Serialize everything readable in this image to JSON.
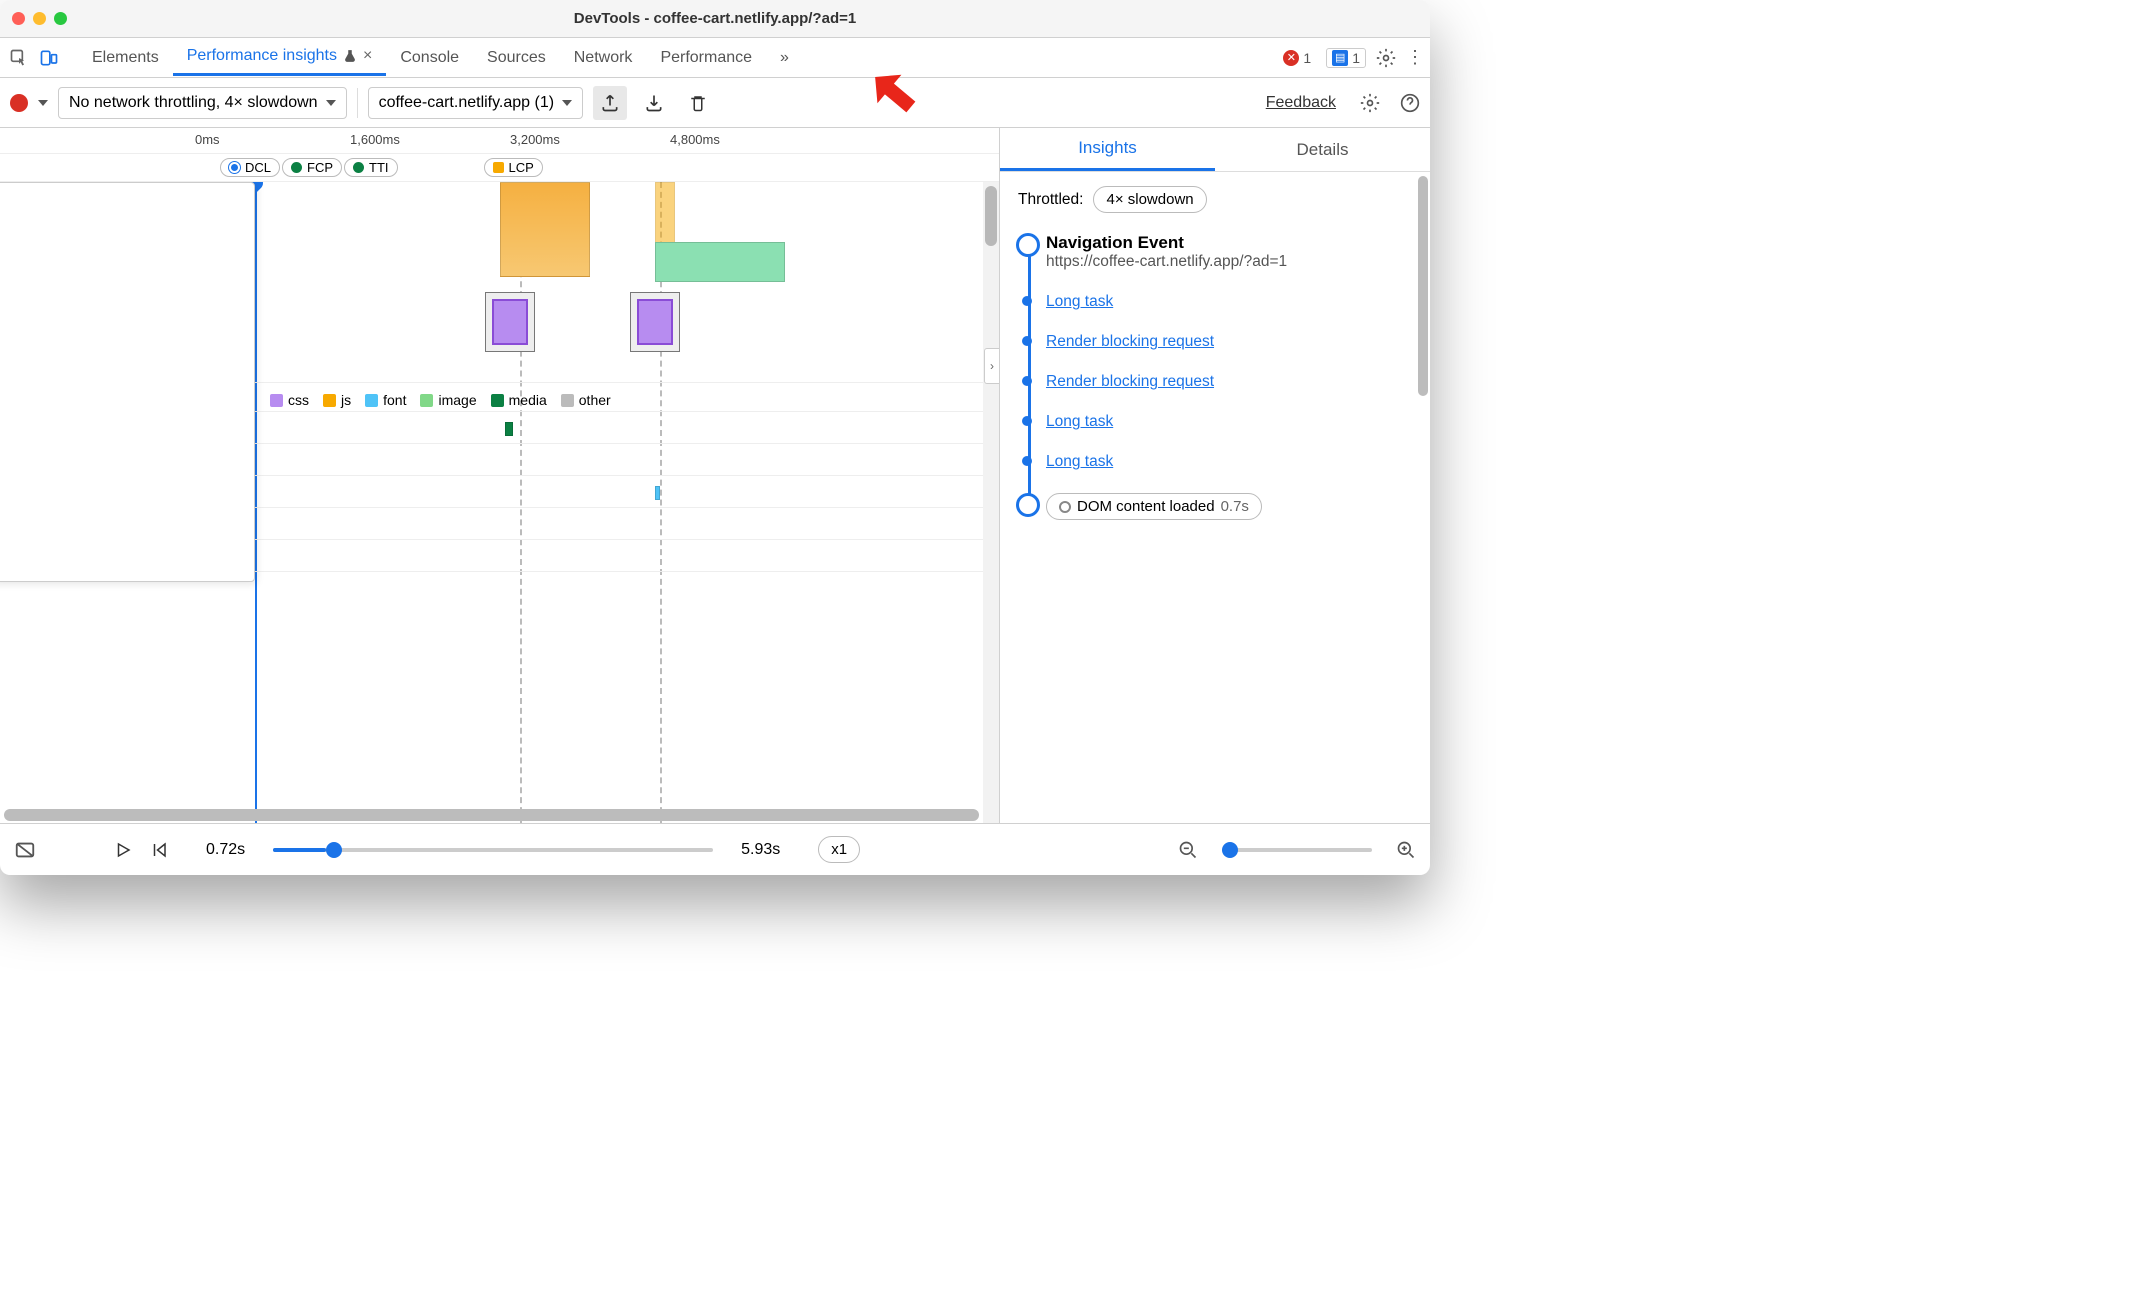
{
  "window_title": "DevTools - coffee-cart.netlify.app/?ad=1",
  "tabs": {
    "elements": "Elements",
    "perf_insights": "Performance insights",
    "console": "Console",
    "sources": "Sources",
    "network": "Network",
    "performance": "Performance"
  },
  "badges": {
    "errors": "1",
    "messages": "1"
  },
  "toolbar": {
    "throttle_select": "No network throttling, 4× slowdown",
    "recording_select": "coffee-cart.netlify.app (1)",
    "feedback": "Feedback"
  },
  "ruler": {
    "t0": "0ms",
    "t1": "1,600ms",
    "t2": "3,200ms",
    "t3": "4,800ms"
  },
  "markers": {
    "dcl": "DCL",
    "fcp": "FCP",
    "tti": "TTI",
    "lcp": "LCP"
  },
  "legend": {
    "css": "css",
    "js": "js",
    "font": "font",
    "image": "image",
    "media": "media",
    "other": "other"
  },
  "sidepanel": {
    "tab_insights": "Insights",
    "tab_details": "Details",
    "throttled_label": "Throttled:",
    "throttled_value": "4× slowdown",
    "nav_title": "Navigation Event",
    "nav_url": "https://coffee-cart.netlify.app/?ad=1",
    "items": {
      "long1": "Long task",
      "rbr1": "Render blocking request",
      "rbr2": "Render blocking request",
      "long2": "Long task",
      "long3": "Long task",
      "dcl": "DOM content loaded",
      "dcl_time": "0.7s"
    }
  },
  "footer": {
    "time_cur": "0.72s",
    "time_end": "5.93s",
    "speed": "x1"
  }
}
